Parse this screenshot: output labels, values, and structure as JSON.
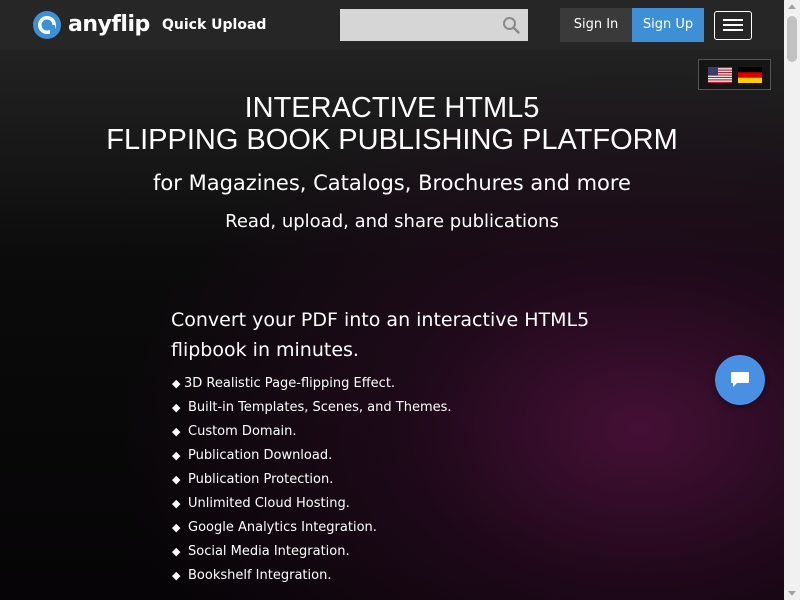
{
  "header": {
    "logo_text": "anyflip",
    "quick_upload": "Quick Upload",
    "search": {
      "value": "",
      "placeholder": ""
    },
    "sign_in": "Sign In",
    "sign_up": "Sign Up"
  },
  "language": {
    "options": [
      "flag-us-icon",
      "flag-de-icon"
    ]
  },
  "hero": {
    "title_line1": "INTERACTIVE HTML5",
    "title_line2": "FLIPPING BOOK PUBLISHING PLATFORM",
    "subtitle": "for Magazines, Catalogs, Brochures and more",
    "tagline": "Read, upload, and share publications"
  },
  "features": {
    "heading_line1": "Convert your PDF into an interactive HTML5",
    "heading_line2": "flipbook in minutes.",
    "bullet": "◆",
    "items": [
      "3D Realistic Page-flipping Effect.",
      "Built-in Templates, Scenes, and Themes.",
      "Custom Domain.",
      "Publication Download.",
      "Publication Protection.",
      "Unlimited Cloud Hosting.",
      "Google Analytics Integration.",
      "Social Media Integration.",
      "Bookshelf Integration."
    ]
  },
  "colors": {
    "header_bg": "#262626",
    "sign_in_bg": "#3a3a3a",
    "sign_up_bg": "#3d8fd6",
    "chat_bg": "#4a90e2",
    "logo_blue": "#3d8fd6",
    "hero_accent": "#481038"
  }
}
